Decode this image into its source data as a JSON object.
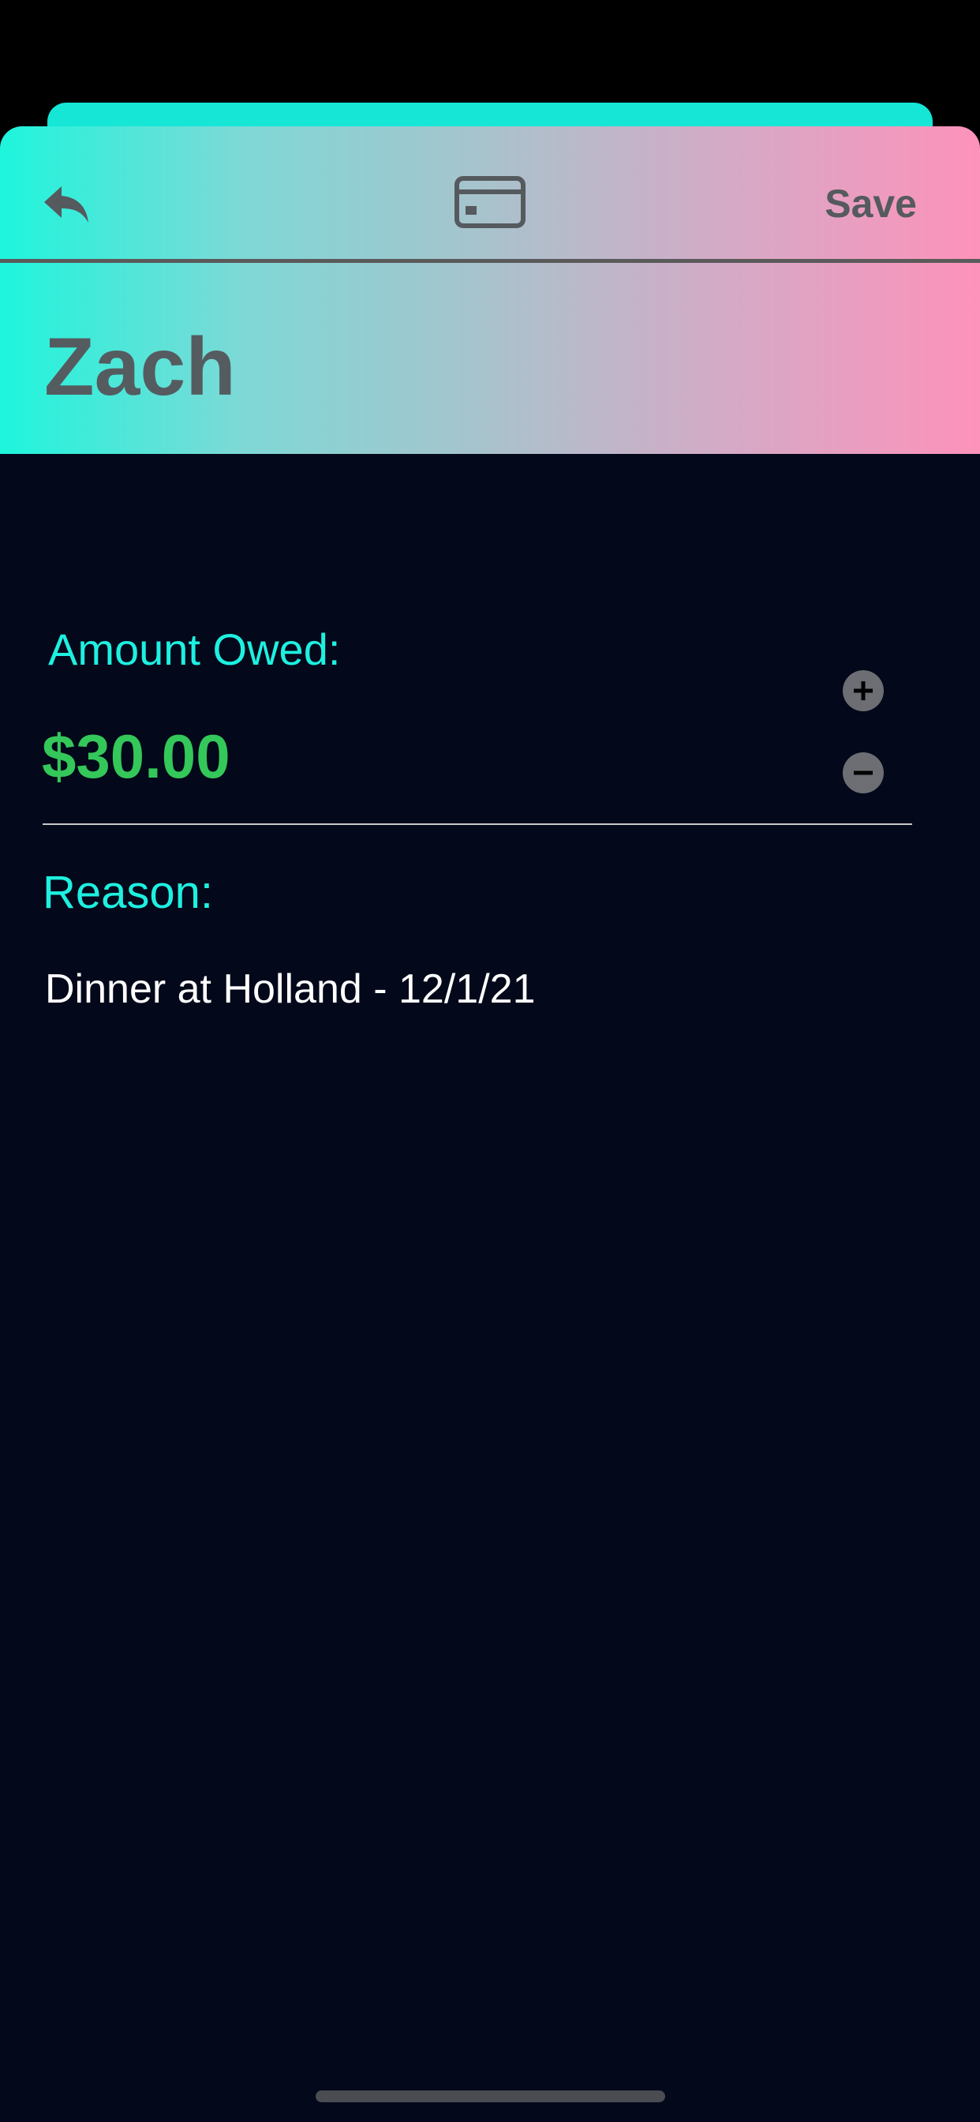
{
  "header": {
    "title": "Zach",
    "save_label": "Save",
    "back_icon": "reply-arrow-icon",
    "card_icon": "credit-card-icon"
  },
  "amount": {
    "label": "Amount Owed:",
    "value": "$30.00",
    "increment_icon": "plus-circle-icon",
    "decrement_icon": "minus-circle-icon"
  },
  "reason": {
    "label": "Reason:",
    "value": "Dinner at Holland - 12/1/21"
  },
  "colors": {
    "accent_cyan": "#1ef0e0",
    "amount_green": "#34c759",
    "gradient_start": "#1ef5dc",
    "gradient_end": "#fd92ba",
    "background": "#03081a"
  }
}
